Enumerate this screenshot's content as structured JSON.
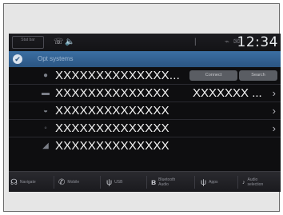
{
  "status_bar": {
    "left_label": "Stat bar",
    "clock": "12:34"
  },
  "title_bar": {
    "title": "Opt systems"
  },
  "rows": [
    {
      "label": "XXXXXXXXXXXXXX...",
      "value": "",
      "has_pills": true,
      "pills": [
        "Connect",
        "Search"
      ],
      "icon": "pin-icon"
    },
    {
      "label": "XXXXXXXXXXXXXX",
      "value": "XXXXXXX ...",
      "has_pills": false,
      "icon": "car-icon"
    },
    {
      "label": "XXXXXXXXXXXXXX",
      "value": "",
      "has_pills": false,
      "icon": "wifi-icon"
    },
    {
      "label": "XXXXXXXXXXXXXX",
      "value": "",
      "has_pills": false,
      "icon": "phone-icon"
    },
    {
      "label": "XXXXXXXXXXXXXX",
      "value": "",
      "has_pills": false,
      "icon": "signal-icon"
    }
  ],
  "bottom_nav": [
    {
      "label": "Navigate",
      "icon": "headset-icon"
    },
    {
      "label": "Mobile",
      "icon": "phone-icon"
    },
    {
      "label": "USB",
      "icon": "usb-icon"
    },
    {
      "label": "Bluetooth Audio",
      "icon": "bluetooth-icon"
    },
    {
      "label": "Apps",
      "icon": "usb-icon"
    },
    {
      "label": "Audio selection",
      "icon": "audio-icon"
    }
  ]
}
